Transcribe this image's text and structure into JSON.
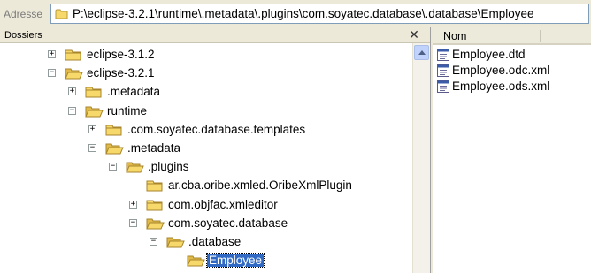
{
  "address": {
    "label": "Adresse",
    "path": "P:\\eclipse-3.2.1\\runtime\\.metadata\\.plugins\\com.soyatec.database\\.database\\Employee"
  },
  "folders_pane": {
    "title": "Dossiers",
    "close_glyph": "✕",
    "tree": [
      {
        "label": "eclipse-3.1.2",
        "expander": "+"
      },
      {
        "label": "eclipse-3.2.1",
        "expander": "−"
      },
      {
        "label": ".metadata",
        "expander": "+"
      },
      {
        "label": "runtime",
        "expander": "−"
      },
      {
        "label": ".com.soyatec.database.templates",
        "expander": "+"
      },
      {
        "label": ".metadata",
        "expander": "−"
      },
      {
        "label": ".plugins",
        "expander": "−"
      },
      {
        "label": "ar.cba.oribe.xmled.OribeXmlPlugin",
        "expander": ""
      },
      {
        "label": "com.objfac.xmleditor",
        "expander": "+"
      },
      {
        "label": "com.soyatec.database",
        "expander": "−"
      },
      {
        "label": ".database",
        "expander": "−"
      },
      {
        "label": "Employee",
        "expander": "",
        "selected": true
      }
    ]
  },
  "files_pane": {
    "column_name": "Nom",
    "files": [
      {
        "name": "Employee.dtd",
        "icon": "dtd-file-icon"
      },
      {
        "name": "Employee.odc.xml",
        "icon": "xml-file-icon"
      },
      {
        "name": "Employee.ods.xml",
        "icon": "xml-file-icon"
      }
    ]
  },
  "colors": {
    "folder": "#f6d86b",
    "selection": "#316ac5",
    "chrome": "#ece9d8"
  }
}
